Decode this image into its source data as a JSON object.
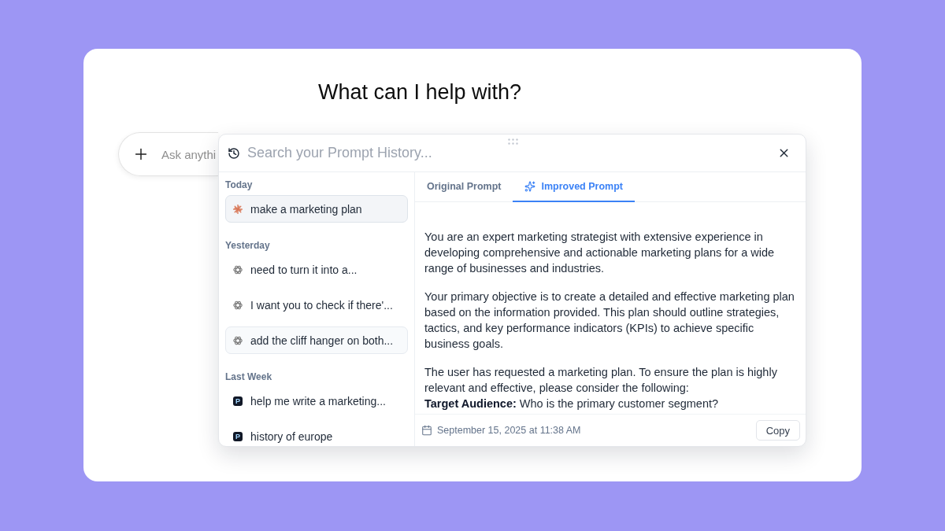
{
  "page": {
    "heading": "What can I help with?"
  },
  "composer": {
    "placeholder": "Ask anythi"
  },
  "history_panel": {
    "search": {
      "placeholder": "Search your Prompt History..."
    },
    "groups": [
      {
        "label": "Today",
        "items": [
          {
            "kind": "burst",
            "text": "make a marketing plan",
            "selected": true,
            "hovered": false
          }
        ]
      },
      {
        "label": "Yesterday",
        "items": [
          {
            "kind": "rosette",
            "text": "need to turn it into a...",
            "selected": false,
            "hovered": false
          },
          {
            "kind": "rosette",
            "text": "I want you to check if there'...",
            "selected": false,
            "hovered": false
          },
          {
            "kind": "rosette",
            "text": "add the cliff hanger on both...",
            "selected": false,
            "hovered": true
          }
        ]
      },
      {
        "label": "Last Week",
        "items": [
          {
            "kind": "letter",
            "letter": "P",
            "text": "help me write a marketing...",
            "selected": false,
            "hovered": false
          },
          {
            "kind": "letter",
            "letter": "P",
            "text": "history of europe",
            "selected": false,
            "hovered": false
          }
        ]
      }
    ],
    "tabs": [
      {
        "kind": "plain",
        "label": "Original Prompt",
        "selected": false
      },
      {
        "kind": "sparkle",
        "label": "Improved Prompt",
        "selected": true
      }
    ],
    "prompt": {
      "paragraphs": [
        [
          "You are an expert marketing strategist with extensive experience in developing comprehensive and actionable marketing plans for a wide range of businesses and industries."
        ],
        [
          "Your primary objective is to create a detailed and effective marketing plan based on the information provided. This plan should outline strategies, tactics, and key performance indicators (KPIs) to achieve specific business goals."
        ],
        [
          "The user has requested a marketing plan. To ensure the plan is highly relevant and effective, please consider the following:",
          "**Target Audience:** Who is the primary customer segment?"
        ]
      ]
    },
    "footer": {
      "timestamp": "September 15, 2025 at 11:38 AM",
      "copy_button": "Copy"
    }
  }
}
